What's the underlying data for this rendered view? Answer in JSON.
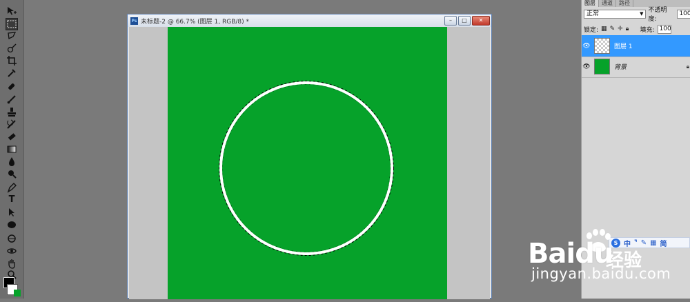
{
  "toolbar": {
    "tools": [
      "move",
      "rectangular-marquee",
      "lasso",
      "quick-selection",
      "crop",
      "eyedropper",
      "healing-brush",
      "brush",
      "clone-stamp",
      "history-brush",
      "eraser",
      "gradient",
      "blur",
      "dodge",
      "pen",
      "type",
      "path-selection",
      "shape",
      "3d-rotate",
      "3d-orbit",
      "hand",
      "zoom"
    ],
    "foreground_color": "#000000",
    "background_color": "#ffffff"
  },
  "document": {
    "title": "未标题-2 @ 66.7% (图层 1, RGB/8) *",
    "canvas_color": "#06a22a",
    "selection_shape": "circle ring"
  },
  "layers_panel": {
    "tabs": [
      "图层",
      "通道",
      "路径"
    ],
    "blend_mode": "正常",
    "opacity_label": "不透明度:",
    "opacity_value": "100%",
    "lock_label": "锁定:",
    "fill_label": "填充:",
    "fill_value": "100%",
    "layers": [
      {
        "name": "图层 1",
        "selected": true,
        "thumb": "transparent"
      },
      {
        "name": "背景",
        "selected": false,
        "thumb": "#06a22a"
      }
    ]
  },
  "ime_bar": {
    "items": [
      "中",
      "简"
    ]
  },
  "watermark": {
    "logo": "Baidu",
    "subtitle": "经验",
    "url": "jingyan.baidu.com"
  }
}
